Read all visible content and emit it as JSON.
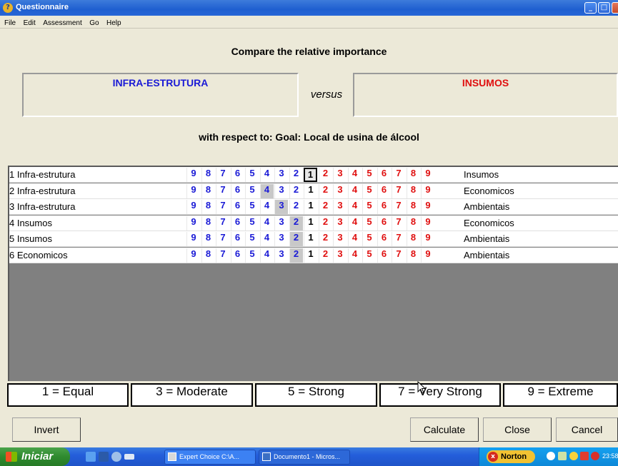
{
  "window": {
    "title": "Questionnaire",
    "buttons": [
      "_",
      "□",
      "x"
    ]
  },
  "menu": [
    "File",
    "Edit",
    "Assessment",
    "Go",
    "Help"
  ],
  "header": {
    "prompt": "Compare the relative importance",
    "left_element": "INFRA-ESTRUTURA",
    "versus": "versus",
    "right_element": "INSUMOS",
    "respect": "with respect to: Goal: Local de usina de álcool"
  },
  "scale_numbers": [
    "9",
    "8",
    "7",
    "6",
    "5",
    "4",
    "3",
    "2",
    "1",
    "2",
    "3",
    "4",
    "5",
    "6",
    "7",
    "8",
    "9"
  ],
  "rows": [
    {
      "num": "1",
      "left": "Infra-estrutura",
      "right": "Insumos",
      "selected": 8,
      "focus": true
    },
    {
      "num": "2",
      "left": "Infra-estrutura",
      "right": "Economicos",
      "selected": 5,
      "focus": false
    },
    {
      "num": "3",
      "left": "Infra-estrutura",
      "right": "Ambientais",
      "selected": 6,
      "focus": false
    },
    {
      "num": "4",
      "left": "Insumos",
      "right": "Economicos",
      "selected": 7,
      "focus": false
    },
    {
      "num": "5",
      "left": "Insumos",
      "right": "Ambientais",
      "selected": 7,
      "focus": false
    },
    {
      "num": "6",
      "left": "Economicos",
      "right": "Ambientais",
      "selected": 7,
      "focus": false
    }
  ],
  "legend": [
    "1 = Equal",
    "3 = Moderate",
    "5 = Strong",
    "7 = Very Strong",
    "9 = Extreme"
  ],
  "buttons": {
    "invert": "Invert",
    "calculate": "Calculate",
    "close": "Close",
    "cancel": "Cancel"
  },
  "taskbar": {
    "start": "Iniciar",
    "tasks": [
      "Expert Choice   C:\\A...",
      "Documento1 - Micros..."
    ],
    "norton": "Norton",
    "clock": "23:58"
  },
  "colors": {
    "left_blue": "#1a1ad6",
    "right_red": "#e01010",
    "titlebar": "#2766d6"
  }
}
